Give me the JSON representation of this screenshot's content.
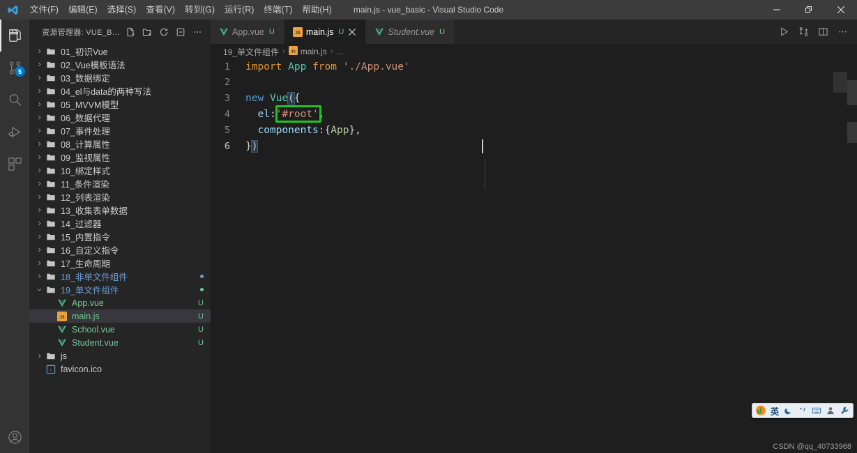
{
  "window": {
    "title": "main.js - vue_basic - Visual Studio Code",
    "logo_icon": "vscode-logo-icon",
    "controls": {
      "minimize": "minimize-icon",
      "restore": "restore-icon",
      "close": "close-icon"
    }
  },
  "menubar": [
    {
      "label": "文件(F)",
      "name": "menu-file"
    },
    {
      "label": "编辑(E)",
      "name": "menu-edit"
    },
    {
      "label": "选择(S)",
      "name": "menu-selection"
    },
    {
      "label": "查看(V)",
      "name": "menu-view"
    },
    {
      "label": "转到(G)",
      "name": "menu-go"
    },
    {
      "label": "运行(R)",
      "name": "menu-run"
    },
    {
      "label": "终端(T)",
      "name": "menu-terminal"
    },
    {
      "label": "帮助(H)",
      "name": "menu-help"
    }
  ],
  "activitybar": {
    "items": [
      {
        "name": "activity-explorer",
        "icon": "files-icon",
        "active": true,
        "badge": ""
      },
      {
        "name": "activity-source-control",
        "icon": "source-control-icon",
        "active": false,
        "badge": "5"
      },
      {
        "name": "activity-search",
        "icon": "search-icon",
        "active": false,
        "badge": ""
      },
      {
        "name": "activity-run-debug",
        "icon": "run-debug-icon",
        "active": false,
        "badge": ""
      },
      {
        "name": "activity-extensions",
        "icon": "extensions-icon",
        "active": false,
        "badge": ""
      }
    ],
    "bottom": [
      {
        "name": "activity-accounts",
        "icon": "account-icon"
      }
    ]
  },
  "sidebar": {
    "title": "资源管理器: VUE_BASIC",
    "actions": [
      {
        "name": "new-file-button",
        "icon": "new-file-icon"
      },
      {
        "name": "new-folder-button",
        "icon": "new-folder-icon"
      },
      {
        "name": "refresh-explorer-button",
        "icon": "refresh-icon"
      },
      {
        "name": "collapse-folders-button",
        "icon": "collapse-all-icon"
      },
      {
        "name": "explorer-more-button",
        "icon": "ellipsis-icon"
      }
    ],
    "tree": [
      {
        "label": "01_初识Vue",
        "type": "folder",
        "depth": 0,
        "expanded": false,
        "status": "",
        "badge": "",
        "selected": false
      },
      {
        "label": "02_Vue模板语法",
        "type": "folder",
        "depth": 0,
        "expanded": false,
        "status": "",
        "badge": "",
        "selected": false
      },
      {
        "label": "03_数据绑定",
        "type": "folder",
        "depth": 0,
        "expanded": false,
        "status": "",
        "badge": "",
        "selected": false
      },
      {
        "label": "04_el与data的两种写法",
        "type": "folder",
        "depth": 0,
        "expanded": false,
        "status": "",
        "badge": "",
        "selected": false
      },
      {
        "label": "05_MVVM模型",
        "type": "folder",
        "depth": 0,
        "expanded": false,
        "status": "",
        "badge": "",
        "selected": false
      },
      {
        "label": "06_数据代理",
        "type": "folder",
        "depth": 0,
        "expanded": false,
        "status": "",
        "badge": "",
        "selected": false
      },
      {
        "label": "07_事件处理",
        "type": "folder",
        "depth": 0,
        "expanded": false,
        "status": "",
        "badge": "",
        "selected": false
      },
      {
        "label": "08_计算属性",
        "type": "folder",
        "depth": 0,
        "expanded": false,
        "status": "",
        "badge": "",
        "selected": false
      },
      {
        "label": "09_监视属性",
        "type": "folder",
        "depth": 0,
        "expanded": false,
        "status": "",
        "badge": "",
        "selected": false
      },
      {
        "label": "10_绑定样式",
        "type": "folder",
        "depth": 0,
        "expanded": false,
        "status": "",
        "badge": "",
        "selected": false
      },
      {
        "label": "11_条件渲染",
        "type": "folder",
        "depth": 0,
        "expanded": false,
        "status": "",
        "badge": "",
        "selected": false
      },
      {
        "label": "12_列表渲染",
        "type": "folder",
        "depth": 0,
        "expanded": false,
        "status": "",
        "badge": "",
        "selected": false
      },
      {
        "label": "13_收集表单数据",
        "type": "folder",
        "depth": 0,
        "expanded": false,
        "status": "",
        "badge": "",
        "selected": false
      },
      {
        "label": "14_过滤器",
        "type": "folder",
        "depth": 0,
        "expanded": false,
        "status": "",
        "badge": "",
        "selected": false
      },
      {
        "label": "15_内置指令",
        "type": "folder",
        "depth": 0,
        "expanded": false,
        "status": "",
        "badge": "",
        "selected": false
      },
      {
        "label": "16_自定义指令",
        "type": "folder",
        "depth": 0,
        "expanded": false,
        "status": "",
        "badge": "",
        "selected": false
      },
      {
        "label": "17_生命周期",
        "type": "folder",
        "depth": 0,
        "expanded": false,
        "status": "",
        "badge": "",
        "selected": false
      },
      {
        "label": "18_非单文件组件",
        "type": "folder",
        "depth": 0,
        "expanded": false,
        "status": "modified",
        "badge": "dot-blue",
        "selected": false
      },
      {
        "label": "19_单文件组件",
        "type": "folder",
        "depth": 0,
        "expanded": true,
        "status": "modified",
        "badge": "dot-green",
        "selected": false
      },
      {
        "label": "App.vue",
        "type": "vue",
        "depth": 1,
        "expanded": false,
        "status": "untracked",
        "badge": "U",
        "selected": false
      },
      {
        "label": "main.js",
        "type": "js",
        "depth": 1,
        "expanded": false,
        "status": "untracked",
        "badge": "U",
        "selected": true
      },
      {
        "label": "School.vue",
        "type": "vue",
        "depth": 1,
        "expanded": false,
        "status": "untracked",
        "badge": "U",
        "selected": false
      },
      {
        "label": "Student.vue",
        "type": "vue",
        "depth": 1,
        "expanded": false,
        "status": "untracked",
        "badge": "U",
        "selected": false
      },
      {
        "label": "js",
        "type": "folder",
        "depth": 0,
        "expanded": false,
        "status": "",
        "badge": "",
        "selected": false
      },
      {
        "label": "favicon.ico",
        "type": "ico",
        "depth": 0,
        "expanded": false,
        "status": "",
        "badge": "",
        "selected": false
      }
    ]
  },
  "editor": {
    "tabs": [
      {
        "label": "App.vue",
        "icon": "vue-icon",
        "badge": "U",
        "active": false,
        "preview": false,
        "closable": false
      },
      {
        "label": "main.js",
        "icon": "js-icon",
        "badge": "U",
        "active": true,
        "preview": false,
        "closable": true
      },
      {
        "label": "Student.vue",
        "icon": "vue-icon",
        "badge": "U",
        "active": false,
        "preview": true,
        "closable": false
      }
    ],
    "actions": [
      {
        "name": "run-code-button",
        "icon": "play-icon"
      },
      {
        "name": "split-terminal-button",
        "icon": "split-changes-icon"
      },
      {
        "name": "split-editor-button",
        "icon": "split-editor-icon"
      },
      {
        "name": "editor-more-button",
        "icon": "ellipsis-icon"
      }
    ],
    "breadcrumb": [
      {
        "label": "19_单文件组件",
        "icon": ""
      },
      {
        "label": "main.js",
        "icon": "js-icon"
      },
      {
        "label": "...",
        "icon": ""
      }
    ],
    "breadcrumb_separator": "›",
    "lines": [
      {
        "number": "1",
        "text": "import App from './App.vue'"
      },
      {
        "number": "2",
        "text": ""
      },
      {
        "number": "3",
        "text": "new Vue({"
      },
      {
        "number": "4",
        "text": "  el:'#root',"
      },
      {
        "number": "5",
        "text": "  components:{App},"
      },
      {
        "number": "6",
        "text": "})"
      }
    ],
    "current_line": "6",
    "annotation": {
      "name": "green-highlight-box",
      "target_text": "'#root'",
      "color": "#22c322"
    }
  },
  "ime_toolbar": {
    "items": [
      {
        "name": "sogou-logo-icon",
        "glyph": ""
      },
      {
        "name": "input-language-toggle",
        "glyph": "英"
      },
      {
        "name": "moon-icon",
        "glyph": ""
      },
      {
        "name": "punctuation-icon",
        "glyph": ""
      },
      {
        "name": "soft-keyboard-icon",
        "glyph": ""
      },
      {
        "name": "user-icon",
        "glyph": ""
      },
      {
        "name": "settings-wrench-icon",
        "glyph": ""
      }
    ]
  },
  "watermark": {
    "text": "CSDN @qq_40733968"
  }
}
